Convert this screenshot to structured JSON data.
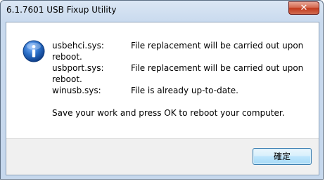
{
  "window": {
    "title": "6.1.7601 USB Fixup Utility",
    "close_glyph": "✕"
  },
  "dialog": {
    "icon": "information-icon",
    "files": [
      {
        "name": "usbehci.sys:",
        "status": "File replacement will be carried out upon reboot."
      },
      {
        "name": "usbport.sys:",
        "status": "File replacement will be carried out upon reboot."
      },
      {
        "name": "winusb.sys:",
        "status": "File is already up-to-date."
      }
    ],
    "instruction": "Save your work and press OK to reboot your computer.",
    "ok_label": "確定"
  },
  "colors": {
    "accent": "#2a6ec6",
    "close_red": "#c1391c"
  }
}
